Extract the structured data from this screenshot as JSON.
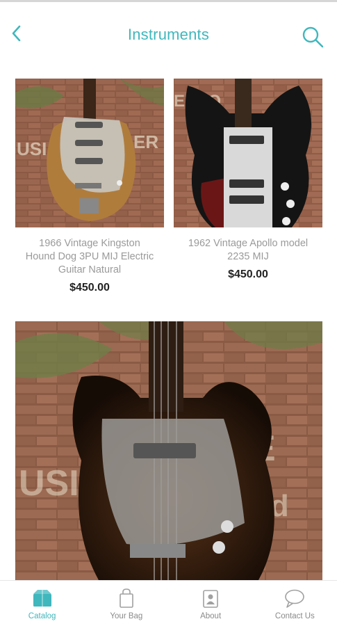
{
  "header": {
    "title": "Instruments"
  },
  "products": [
    {
      "name_line1": "1966 Vintage Kingston",
      "name_line2": "Hound Dog 3PU MIJ Electric",
      "name_line3": "Guitar Natural",
      "price": "$450.00"
    },
    {
      "name_line1": "1962 Vintage Apollo model",
      "name_line2": "2235 MIJ",
      "price": "$450.00"
    }
  ],
  "tabs": [
    {
      "label": "Catalog",
      "icon": "catalog-icon",
      "active": true
    },
    {
      "label": "Your Bag",
      "icon": "bag-icon",
      "active": false
    },
    {
      "label": "About",
      "icon": "about-icon",
      "active": false
    },
    {
      "label": "Contact Us",
      "icon": "chat-icon",
      "active": false
    }
  ],
  "colors": {
    "accent": "#3fb7bd",
    "text_muted": "#9a9a9a",
    "price": "#222222"
  }
}
